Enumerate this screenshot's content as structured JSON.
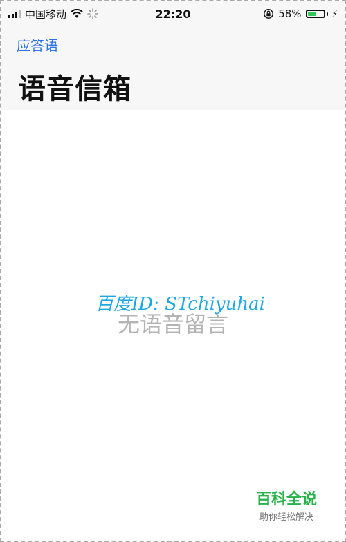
{
  "status_bar": {
    "carrier": "中国移动",
    "time": "22:20",
    "battery_percent": "58%",
    "battery_level": 0.58,
    "icons": [
      "signal-icon",
      "wifi-icon",
      "loading-icon",
      "orientation-lock-icon",
      "battery-icon",
      "charging-icon"
    ]
  },
  "nav": {
    "back_label": "应答语",
    "title": "语音信箱"
  },
  "content": {
    "empty_text": "无语音留言"
  },
  "watermark": {
    "id_text": "百度ID: STchiyuhai",
    "brand_name": "百科全说",
    "brand_tagline": "助你轻松解决"
  },
  "colors": {
    "link": "#2b72e8",
    "battery": "#34c759",
    "watermark_blue": "#1ea8e0",
    "brand_green": "#28b24a"
  }
}
